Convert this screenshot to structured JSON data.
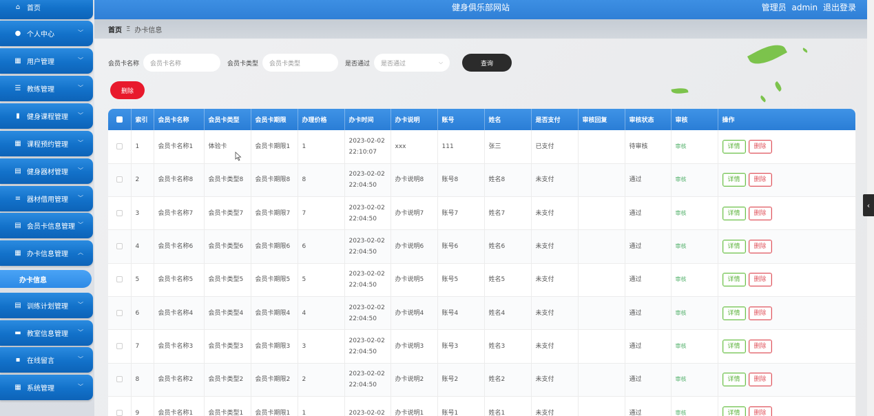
{
  "header": {
    "site_title": "健身俱乐部网站",
    "role_label": "管理员",
    "username": "admin",
    "logout": "退出登录"
  },
  "sidebar": {
    "items": [
      {
        "label": "首页",
        "icon": "home-icon",
        "glyph": "⌂",
        "has_chevron": false
      },
      {
        "label": "个人中心",
        "icon": "user-icon",
        "glyph": "●",
        "has_chevron": true
      },
      {
        "label": "用户管理",
        "icon": "grid-icon",
        "glyph": "▦",
        "has_chevron": true
      },
      {
        "label": "教练管理",
        "icon": "sliders-icon",
        "glyph": "☰",
        "has_chevron": true
      },
      {
        "label": "健身课程管理",
        "icon": "chart-icon",
        "glyph": "▮",
        "has_chevron": true
      },
      {
        "label": "课程预约管理",
        "icon": "grid-icon",
        "glyph": "▦",
        "has_chevron": true
      },
      {
        "label": "健身器材管理",
        "icon": "file-icon",
        "glyph": "▤",
        "has_chevron": true
      },
      {
        "label": "器材借用管理",
        "icon": "list-icon",
        "glyph": "≡",
        "has_chevron": true
      },
      {
        "label": "会员卡信息管理",
        "icon": "clipboard-icon",
        "glyph": "▤",
        "has_chevron": true
      },
      {
        "label": "办卡信息管理",
        "icon": "grid-icon",
        "glyph": "▦",
        "has_chevron": true,
        "expanded": true
      },
      {
        "label": "训练计划管理",
        "icon": "file-icon",
        "glyph": "▤",
        "has_chevron": true
      },
      {
        "label": "教室信息管理",
        "icon": "monitor-icon",
        "glyph": "▬",
        "has_chevron": true
      },
      {
        "label": "在线留言",
        "icon": "message-icon",
        "glyph": "▪",
        "has_chevron": true
      },
      {
        "label": "系统管理",
        "icon": "grid-icon",
        "glyph": "▦",
        "has_chevron": true
      }
    ],
    "sub_item": "办卡信息"
  },
  "breadcrumb": {
    "home": "首页",
    "separator": "Ξ",
    "current": "办卡信息"
  },
  "search": {
    "card_name_label": "会员卡名称",
    "card_name_placeholder": "会员卡名称",
    "card_type_label": "会员卡类型",
    "card_type_placeholder": "会员卡类型",
    "approved_label": "是否通过",
    "approved_placeholder": "是否通过",
    "query_button": "查询",
    "delete_button": "删除"
  },
  "table": {
    "headers": [
      "索引",
      "会员卡名称",
      "会员卡类型",
      "会员卡期限",
      "办理价格",
      "办卡时间",
      "办卡说明",
      "账号",
      "姓名",
      "是否支付",
      "审核回复",
      "审核状态",
      "审核",
      "操作"
    ],
    "audit_label": "审核",
    "detail_label": "详情",
    "delete_label": "删除",
    "rows": [
      {
        "index": "1",
        "name": "会员卡名称1",
        "type": "体验卡",
        "term": "会员卡期限1",
        "price": "1",
        "date": "2023-02-02",
        "time": "22:10:07",
        "desc": "xxx",
        "account": "111",
        "person": "张三",
        "paid": "已支付",
        "reply": "",
        "status": "待审核"
      },
      {
        "index": "2",
        "name": "会员卡名称8",
        "type": "会员卡类型8",
        "term": "会员卡期限8",
        "price": "8",
        "date": "2023-02-02",
        "time": "22:04:50",
        "desc": "办卡说明8",
        "account": "账号8",
        "person": "姓名8",
        "paid": "未支付",
        "reply": "",
        "status": "通过"
      },
      {
        "index": "3",
        "name": "会员卡名称7",
        "type": "会员卡类型7",
        "term": "会员卡期限7",
        "price": "7",
        "date": "2023-02-02",
        "time": "22:04:50",
        "desc": "办卡说明7",
        "account": "账号7",
        "person": "姓名7",
        "paid": "未支付",
        "reply": "",
        "status": "通过"
      },
      {
        "index": "4",
        "name": "会员卡名称6",
        "type": "会员卡类型6",
        "term": "会员卡期限6",
        "price": "6",
        "date": "2023-02-02",
        "time": "22:04:50",
        "desc": "办卡说明6",
        "account": "账号6",
        "person": "姓名6",
        "paid": "未支付",
        "reply": "",
        "status": "通过"
      },
      {
        "index": "5",
        "name": "会员卡名称5",
        "type": "会员卡类型5",
        "term": "会员卡期限5",
        "price": "5",
        "date": "2023-02-02",
        "time": "22:04:50",
        "desc": "办卡说明5",
        "account": "账号5",
        "person": "姓名5",
        "paid": "未支付",
        "reply": "",
        "status": "通过"
      },
      {
        "index": "6",
        "name": "会员卡名称4",
        "type": "会员卡类型4",
        "term": "会员卡期限4",
        "price": "4",
        "date": "2023-02-02",
        "time": "22:04:50",
        "desc": "办卡说明4",
        "account": "账号4",
        "person": "姓名4",
        "paid": "未支付",
        "reply": "",
        "status": "通过"
      },
      {
        "index": "7",
        "name": "会员卡名称3",
        "type": "会员卡类型3",
        "term": "会员卡期限3",
        "price": "3",
        "date": "2023-02-02",
        "time": "22:04:50",
        "desc": "办卡说明3",
        "account": "账号3",
        "person": "姓名3",
        "paid": "未支付",
        "reply": "",
        "status": "通过"
      },
      {
        "index": "8",
        "name": "会员卡名称2",
        "type": "会员卡类型2",
        "term": "会员卡期限2",
        "price": "2",
        "date": "2023-02-02",
        "time": "22:04:50",
        "desc": "办卡说明2",
        "account": "账号2",
        "person": "姓名2",
        "paid": "未支付",
        "reply": "",
        "status": "通过"
      },
      {
        "index": "9",
        "name": "会员卡名称1",
        "type": "会员卡类型1",
        "term": "会员卡期限1",
        "price": "1",
        "date": "2023-02-02",
        "time": "",
        "desc": "办卡说明1",
        "account": "账号1",
        "person": "姓名1",
        "paid": "未支付",
        "reply": "",
        "status": "通过"
      }
    ]
  },
  "colors": {
    "primary": "#2f7fd6",
    "danger": "#e8192c",
    "success": "#5ab23a"
  }
}
